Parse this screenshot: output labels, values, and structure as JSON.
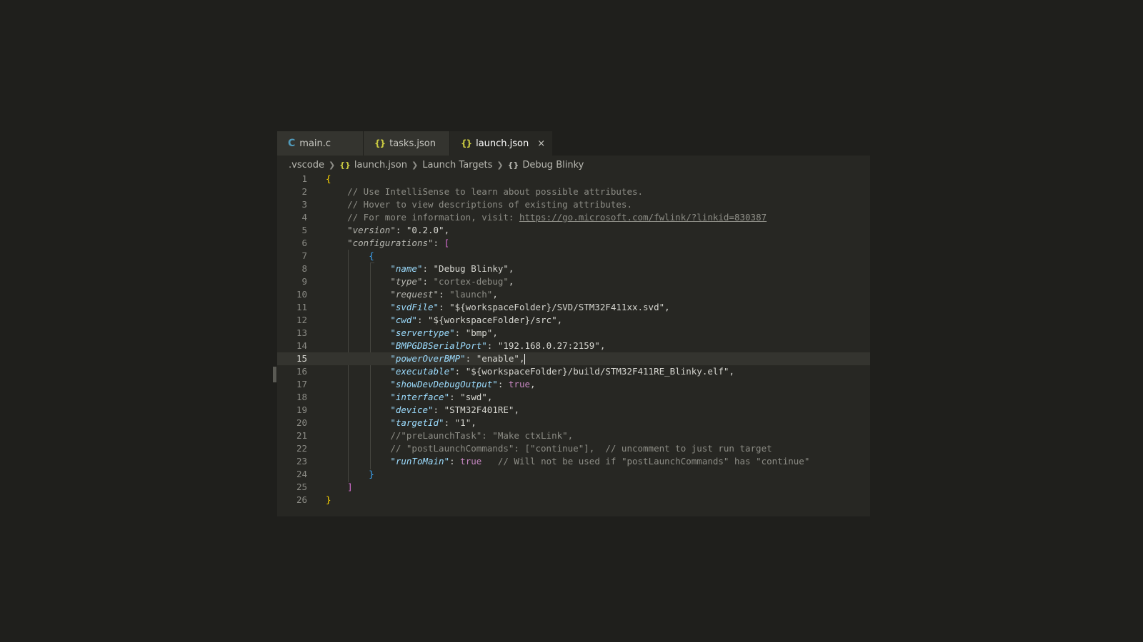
{
  "tabs": [
    {
      "icon": "C",
      "label": "main.c"
    },
    {
      "icon": "{}",
      "label": "tasks.json"
    },
    {
      "icon": "{}",
      "label": "launch.json",
      "close": "×"
    }
  ],
  "breadcrumb": {
    "folder": ".vscode",
    "file_icon": "{}",
    "file": "launch.json",
    "section": "Launch Targets",
    "item_icon": "{}",
    "item": "Debug Blinky"
  },
  "lines": {
    "n": [
      "1",
      "2",
      "3",
      "4",
      "5",
      "6",
      "7",
      "8",
      "9",
      "10",
      "11",
      "12",
      "13",
      "14",
      "15",
      "16",
      "17",
      "18",
      "19",
      "20",
      "21",
      "22",
      "23",
      "24",
      "25",
      "26"
    ],
    "l1": "{",
    "l2": "// Use IntelliSense to learn about possible attributes.",
    "l3": "// Hover to view descriptions of existing attributes.",
    "l4_prefix": "// For more information, visit: ",
    "l4_url": "https://go.microsoft.com/fwlink/?linkid=830387",
    "l5_key": "\"version\"",
    "l5_val": "\"0.2.0\"",
    "l6_key": "\"configurations\"",
    "l6_br": "[",
    "l7": "{",
    "l8_key": "\"name\"",
    "l8_val": "\"Debug Blinky\"",
    "l9_key": "\"type\"",
    "l9_val": "\"cortex-debug\"",
    "l10_key": "\"request\"",
    "l10_val": "\"launch\"",
    "l11_key": "\"svdFile\"",
    "l11_val": "\"${workspaceFolder}/SVD/STM32F411xx.svd\"",
    "l12_key": "\"cwd\"",
    "l12_val": "\"${workspaceFolder}/src\"",
    "l13_key": "\"servertype\"",
    "l13_val": "\"bmp\"",
    "l14_key": "\"BMPGDBSerialPort\"",
    "l14_val": "\"192.168.0.27:2159\"",
    "l15_key": "\"powerOverBMP\"",
    "l15_val": "\"enable\"",
    "l16_key": "\"executable\"",
    "l16_val": "\"${workspaceFolder}/build/STM32F411RE_Blinky.elf\"",
    "l17_key": "\"showDevDebugOutput\"",
    "l17_val": "true",
    "l18_key": "\"interface\"",
    "l18_val": "\"swd\"",
    "l19_key": "\"device\"",
    "l19_val": "\"STM32F401RE\"",
    "l20_key": "\"targetId\"",
    "l20_val": "\"1\"",
    "l21": "//\"preLaunchTask\": \"Make ctxLink\",",
    "l22": "// \"postLaunchCommands\": [\"continue\"],  // uncomment to just run target",
    "l23_key": "\"runToMain\"",
    "l23_val": "true",
    "l23_comment": "// Will not be used if \"postLaunchCommands\" has \"continue\"",
    "l24": "}",
    "l25": "]",
    "l26": "}"
  },
  "colors": {
    "background": "#1f1f1c",
    "editor": "#272723",
    "key": "#9cdcfe",
    "bracket_gold": "#ffd700",
    "bracket_pink": "#da70d6",
    "bracket_blue": "#3da9fc"
  }
}
